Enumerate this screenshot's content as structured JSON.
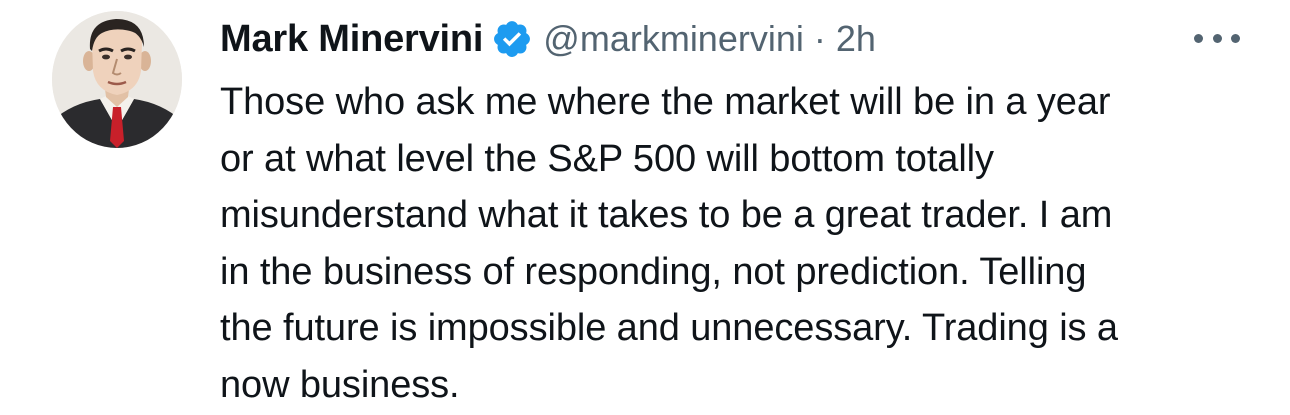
{
  "tweet": {
    "author": {
      "display_name": "Mark Minervini",
      "handle": "@markminervini",
      "verified": true,
      "avatar_icon": "illustrated-portrait-avatar"
    },
    "separator": "·",
    "time": "2h",
    "more_icon": "more-horizontal-icon",
    "text_lines": [
      "Those who ask me where the market will be in a year",
      "or at what level the S&P 500 will bottom totally",
      "misunderstand what it takes to be a great trader. I am",
      "in the business of responding, not prediction. Telling",
      "the future is impossible and unnecessary. Trading is a",
      "now business."
    ]
  },
  "colors": {
    "text_primary": "#0f1419",
    "text_secondary": "#536471",
    "verified_badge": "#1d9bf0",
    "background": "#ffffff"
  }
}
